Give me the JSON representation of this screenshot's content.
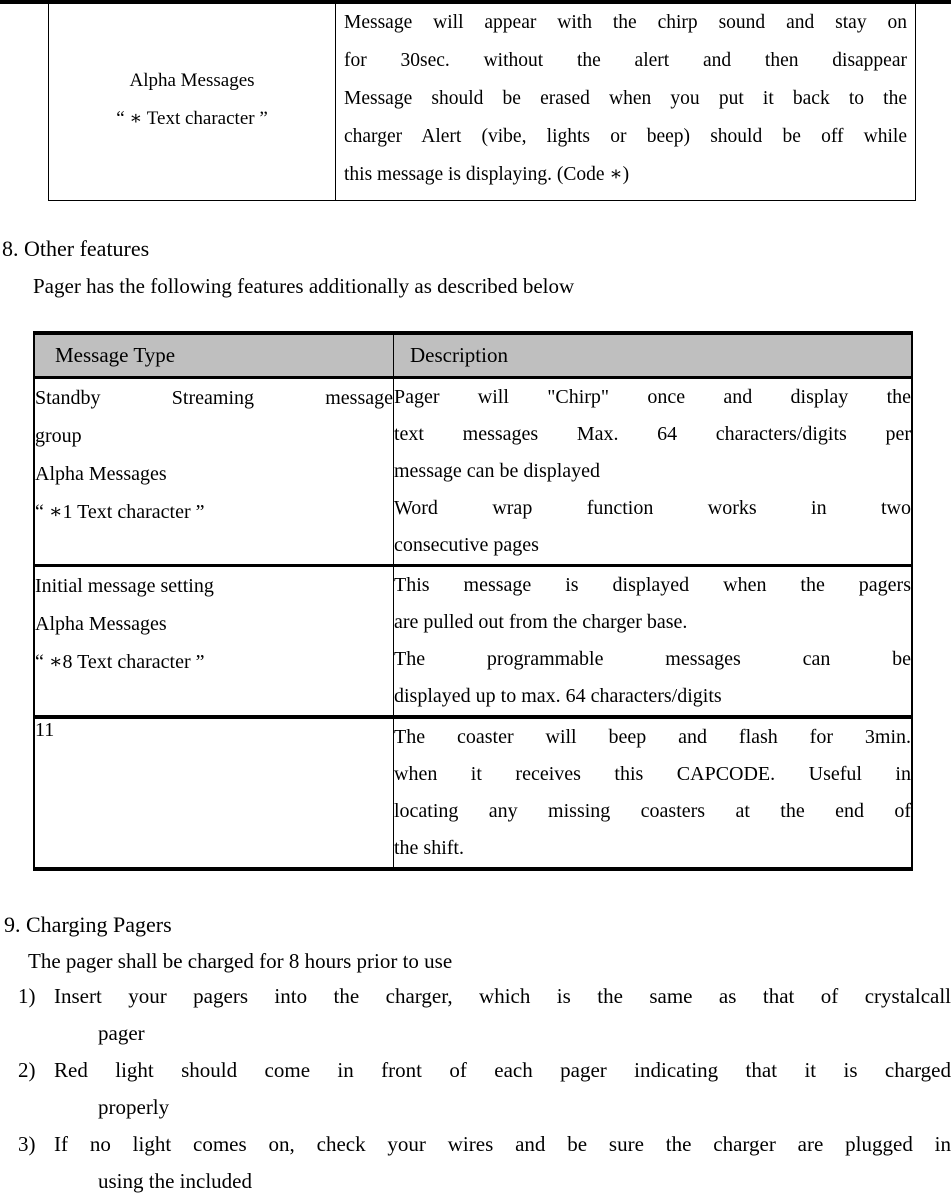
{
  "table_top": {
    "left_cell": {
      "line1": "Alpha Messages",
      "line2": "“ ∗ Text character ”"
    },
    "right_cell": {
      "lines": [
        "Message will appear with the chirp sound and stay on",
        "for 30sec. without    the alert   and then disappear",
        "Message should be erased when you put it back to the",
        "charger Alert (vibe, lights or beep) should be off while",
        "this message is displaying. (Code ∗)"
      ]
    }
  },
  "section8": {
    "heading": "8. Other features",
    "intro": "Pager has the following features additionally as described below",
    "table": {
      "headers": [
        "Message Type",
        "Description"
      ],
      "rows": [
        {
          "type_lines": [
            "Standby  Streaming  message",
            "group",
            " Alpha Messages",
            "“ ∗1   Text character ”"
          ],
          "desc_lines": [
            "Pager  will  \"Chirp\"  once  and    display  the",
            "text messages Max. 64 characters/digits per",
            "message can be displayed",
            "Word    wrap    function    works    in    two",
            "consecutive pages"
          ]
        },
        {
          "type_lines": [
            "Initial message setting",
            "Alpha Messages",
            "“ ∗8   Text character ”"
          ],
          "desc_lines": [
            "This message is displayed when the pagers",
            "are pulled out from the charger base.",
            "The   programmable   messages   can   be",
            "displayed up to max. 64   characters/digits"
          ]
        },
        {
          "type_lines": [
            "11"
          ],
          "desc_lines": [
            "The  coaster  will  beep  and  flash  for  3min.",
            "when  it  receives  this  CAPCODE.  Useful  in",
            "locating  any  missing  coasters  at  the  end  of",
            "the shift."
          ]
        }
      ]
    }
  },
  "section9": {
    "heading": "9. Charging Pagers",
    "intro": "The pager shall be charged for 8 hours prior to use",
    "items": [
      {
        "marker": "1)",
        "line1": "Insert  your  pagers  into  the  charger,  which  is  the  same  as  that  of  crystalcall",
        "line2": "pager"
      },
      {
        "marker": "2)",
        "line1": "Red  light  should  come  in  front  of  each  pager  indicating  that  it  is  charged",
        "line2": "properly"
      },
      {
        "marker": "3)",
        "line1": "If  no  light  comes  on,  check  your  wires  and  be  sure  the  charger  are  plugged  in",
        "line2": "using the included"
      }
    ]
  },
  "style": {
    "header_fill": "#bfbfbf",
    "border_color": "#000000",
    "text_color": "#000000",
    "page_bg": "#ffffff"
  }
}
